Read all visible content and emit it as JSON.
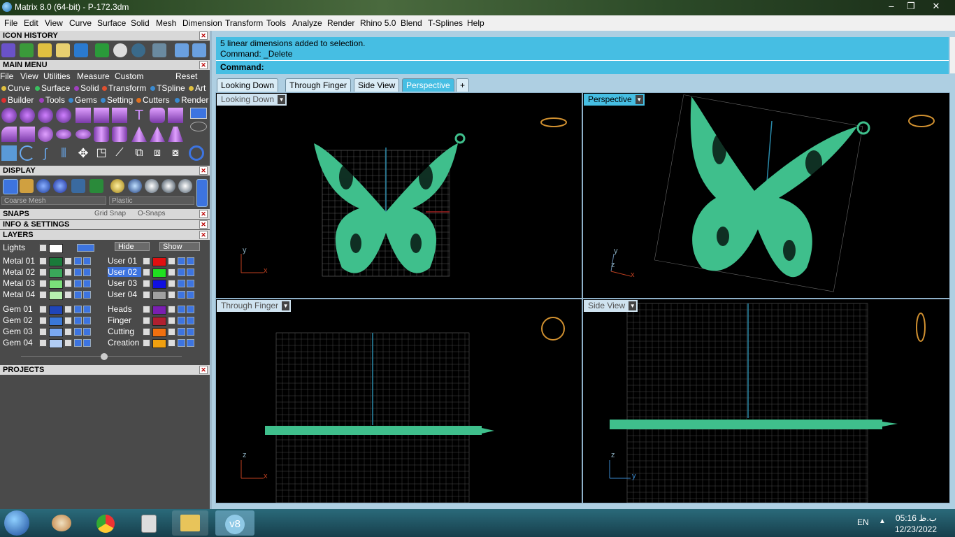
{
  "window": {
    "title": "Matrix 8.0 (64-bit) - P-172.3dm",
    "controls": [
      "–",
      "❐",
      "✕"
    ]
  },
  "menubar": [
    "File",
    "Edit",
    "View",
    "Curve",
    "Surface",
    "Solid",
    "Mesh",
    "Dimension",
    "Transform",
    "Tools",
    "Analyze",
    "Render",
    "Rhino 5.0",
    "Blend",
    "T-Splines",
    "Help"
  ],
  "left_panel": {
    "icon_history_title": "ICON HISTORY",
    "main_menu_title": "MAIN MENU",
    "main_menu_items": [
      "File",
      "View",
      "Utilities",
      "Measure",
      "Custom"
    ],
    "reset_label": "Reset",
    "builder_row1": [
      "Curve",
      "Surface",
      "Solid",
      "Transform",
      "TSpline",
      "Art"
    ],
    "builder_row2": [
      "Builder",
      "Tools",
      "Gems",
      "Setting",
      "Cutters",
      "Render"
    ],
    "display_title": "DISPLAY",
    "display_mesh": "Coarse Mesh",
    "display_material": "Plastic",
    "snaps_title": "SNAPS",
    "grid_snap": "Grid Snap",
    "o_snaps": "O-Snaps",
    "info_title": "INFO & SETTINGS",
    "layers_title": "LAYERS",
    "lights_label": "Lights",
    "hide_label": "Hide",
    "show_label": "Show",
    "layers_left": [
      {
        "name": "Metal 01",
        "color": "#1a7a3a"
      },
      {
        "name": "Metal 02",
        "color": "#3aa85a"
      },
      {
        "name": "Metal 03",
        "color": "#7be07a"
      },
      {
        "name": "Metal 04",
        "color": "#b6f0b0"
      },
      {
        "name": "Gem 01",
        "color": "#1f45b8"
      },
      {
        "name": "Gem 02",
        "color": "#3a78d8"
      },
      {
        "name": "Gem 03",
        "color": "#7aa8f0"
      },
      {
        "name": "Gem 04",
        "color": "#b0ccf4"
      }
    ],
    "layers_right": [
      {
        "name": "User 01",
        "color": "#e01010"
      },
      {
        "name": "User 02",
        "color": "#20e020"
      },
      {
        "name": "User 03",
        "color": "#1010e0"
      },
      {
        "name": "User 04",
        "color": "#a0a0a0"
      },
      {
        "name": "Heads",
        "color": "#7a1fb0"
      },
      {
        "name": "Finger",
        "color": "#b02030"
      },
      {
        "name": "Cutting",
        "color": "#f07010"
      },
      {
        "name": "Creation",
        "color": "#f0a010"
      }
    ],
    "projects_title": "PROJECTS"
  },
  "command": {
    "line1": "5 linear dimensions added to selection.",
    "line2": "Command: _Delete",
    "prompt": "Command:"
  },
  "tabs": [
    "Looking Down",
    "Through Finger",
    "Side View",
    "Perspective"
  ],
  "tab_add": "+",
  "viewports": [
    {
      "label": "Looking Down",
      "axis1": "y",
      "axis2": "x"
    },
    {
      "label": "Perspective",
      "axis1": "y",
      "axis2": "x",
      "axis3": "z"
    },
    {
      "label": "Through Finger",
      "axis1": "z",
      "axis2": "x"
    },
    {
      "label": "Side View",
      "axis1": "z",
      "axis2": "y"
    }
  ],
  "taskbar": {
    "lang": "EN",
    "time": "05:16 ب.ظ",
    "date": "12/23/2022"
  },
  "colors": {
    "accent": "#46bee3",
    "model": "#3fbf8c",
    "panel": "#4a4a4a"
  }
}
